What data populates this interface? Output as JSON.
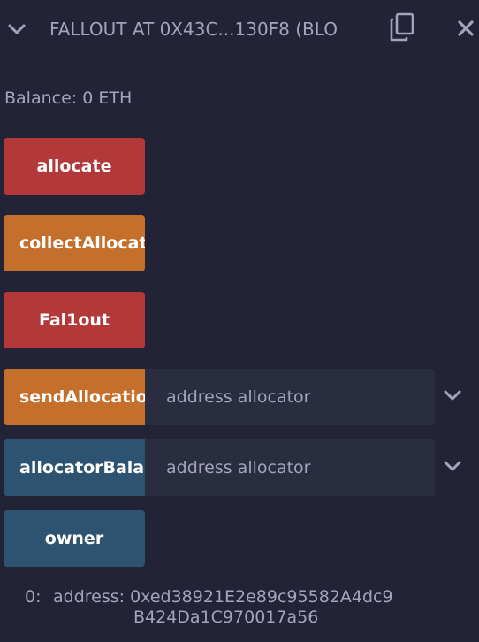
{
  "header": {
    "title": "FALLOUT AT 0X43C...130F8 (BLO",
    "expand_icon": "chevron-down-icon",
    "copy_icon": "copy-icon",
    "close_icon": "close-icon"
  },
  "balance": {
    "label": "Balance: 0 ETH"
  },
  "functions": [
    {
      "label": "allocate",
      "color": "#b2383a"
    },
    {
      "label": "collectAllocations",
      "color": "#c56f2d"
    },
    {
      "label": "Fal1out",
      "color": "#b2383a"
    },
    {
      "label": "sendAllocation",
      "color": "#c56f2d",
      "placeholder": "address allocator"
    },
    {
      "label": "allocatorBalance",
      "color": "#2e5371",
      "placeholder": "address allocator"
    },
    {
      "label": "owner",
      "color": "#2e5371"
    }
  ],
  "result": {
    "index": "0:",
    "line1": "address: 0xed38921E2e89c95582A4dc9",
    "line2": "B424Da1C970017a56"
  },
  "colors": {
    "background": "#222336",
    "input_background": "#2a2c3f",
    "text": "#a2a3bd",
    "danger": "#b2383a",
    "warning": "#c56f2d",
    "info": "#2e5371"
  }
}
